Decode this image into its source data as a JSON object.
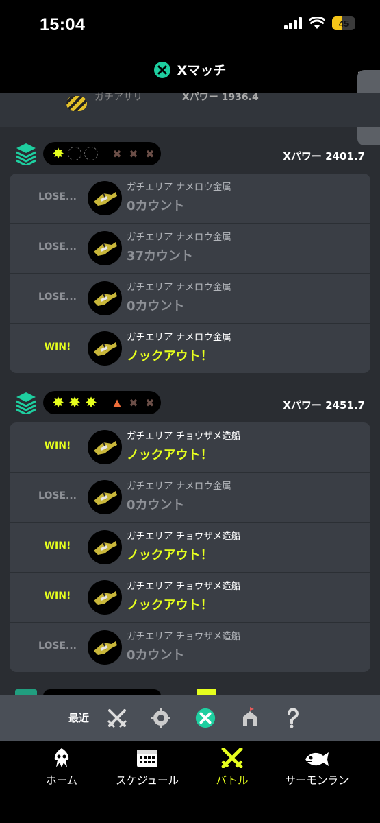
{
  "status": {
    "time": "15:04",
    "battery": "45",
    "battery_level": 0.45
  },
  "nav": {
    "title": "Xマッチ",
    "badge": "X",
    "more": "··"
  },
  "previous": {
    "mode": "ガチアサリ",
    "xpower": "Xパワー 1936.4"
  },
  "sets": [
    {
      "xpower": "Xパワー 2401.7",
      "dots": [
        "win",
        "empty",
        "empty",
        "lose",
        "lose",
        "lose"
      ],
      "matches": [
        {
          "result": "LOSE...",
          "outcome": "lose",
          "mode_stage": "ガチエリア ナメロウ金属",
          "detail": "0カウント"
        },
        {
          "result": "LOSE...",
          "outcome": "lose",
          "mode_stage": "ガチエリア ナメロウ金属",
          "detail": "37カウント"
        },
        {
          "result": "LOSE...",
          "outcome": "lose",
          "mode_stage": "ガチエリア ナメロウ金属",
          "detail": "0カウント"
        },
        {
          "result": "WIN!",
          "outcome": "win",
          "mode_stage": "ガチエリア ナメロウ金属",
          "detail": "ノックアウト！"
        }
      ]
    },
    {
      "xpower": "Xパワー 2451.7",
      "dots": [
        "win",
        "win",
        "win",
        "flag",
        "lose",
        "lose"
      ],
      "matches": [
        {
          "result": "WIN!",
          "outcome": "win",
          "mode_stage": "ガチエリア チョウザメ造船",
          "detail": "ノックアウト！"
        },
        {
          "result": "LOSE...",
          "outcome": "lose",
          "mode_stage": "ガチエリア ナメロウ金属",
          "detail": "0カウント"
        },
        {
          "result": "WIN!",
          "outcome": "win",
          "mode_stage": "ガチエリア チョウザメ造船",
          "detail": "ノックアウト！"
        },
        {
          "result": "WIN!",
          "outcome": "win",
          "mode_stage": "ガチエリア チョウザメ造船",
          "detail": "ノックアウト！"
        },
        {
          "result": "LOSE...",
          "outcome": "lose",
          "mode_stage": "ガチエリア チョウザメ造船",
          "detail": "0カウント"
        }
      ]
    }
  ],
  "recent": {
    "label": "最近",
    "icons": [
      "crossed-weapons-icon",
      "bankara-icon",
      "x-match-icon",
      "event-icon",
      "private-icon"
    ],
    "active": 2
  },
  "tabs": [
    {
      "label": "ホーム",
      "icon": "squid-icon"
    },
    {
      "label": "スケジュール",
      "icon": "calendar-icon"
    },
    {
      "label": "バトル",
      "icon": "battle-icon",
      "active": true
    },
    {
      "label": "サーモンラン",
      "icon": "salmon-icon"
    }
  ],
  "colors": {
    "win": "#e6ff1e",
    "lose": "#8d9096",
    "accent": "#1ecfa0",
    "card": "#3a3e45"
  }
}
